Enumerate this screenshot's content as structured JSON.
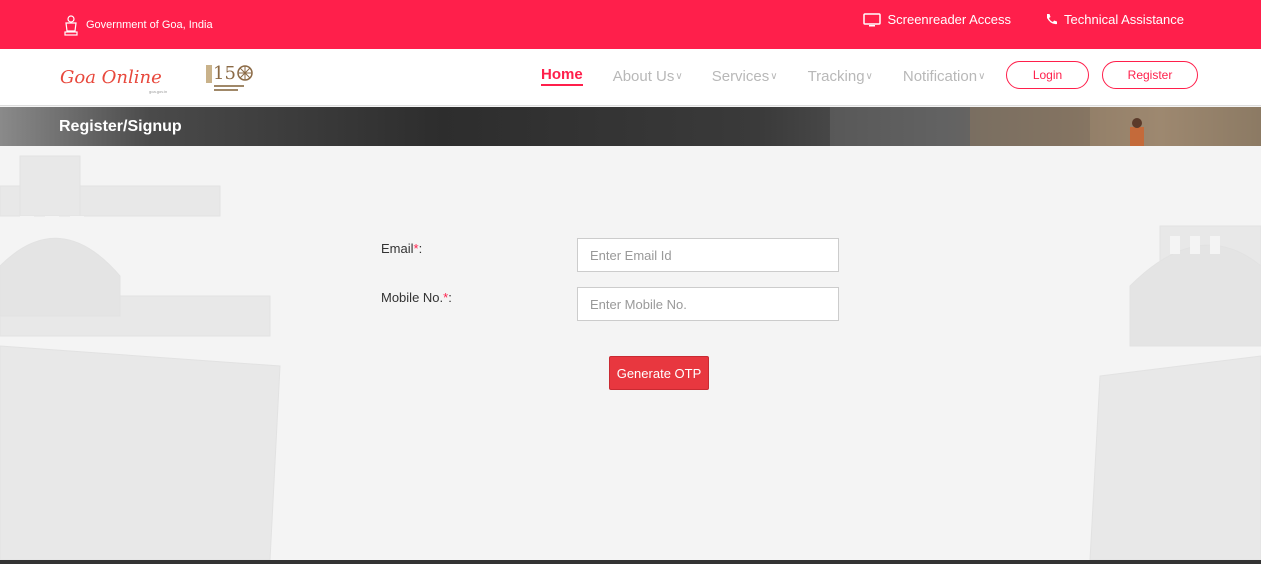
{
  "topbar": {
    "gov_label": "Government of Goa, India",
    "screenreader_label": "Screenreader Access",
    "tech_label": "Technical Assistance"
  },
  "nav": {
    "logo_text": "Goa Online",
    "logo_subtext": "goa.gov.in",
    "menu": [
      {
        "label": "Home",
        "active": true
      },
      {
        "label": "About Us",
        "active": false
      },
      {
        "label": "Services",
        "active": false
      },
      {
        "label": "Tracking",
        "active": false
      },
      {
        "label": "Notification",
        "active": false
      }
    ],
    "login_label": "Login",
    "register_label": "Register"
  },
  "banner": {
    "title": "Register/Signup"
  },
  "form": {
    "email_label": "Email",
    "email_placeholder": "Enter Email Id",
    "mobile_label": "Mobile No.",
    "mobile_placeholder": "Enter Mobile No.",
    "required_mark": "*",
    "colon": ":",
    "otp_button": "Generate OTP"
  },
  "colors": {
    "brand": "#ff1f4b",
    "button": "#e8373f"
  }
}
